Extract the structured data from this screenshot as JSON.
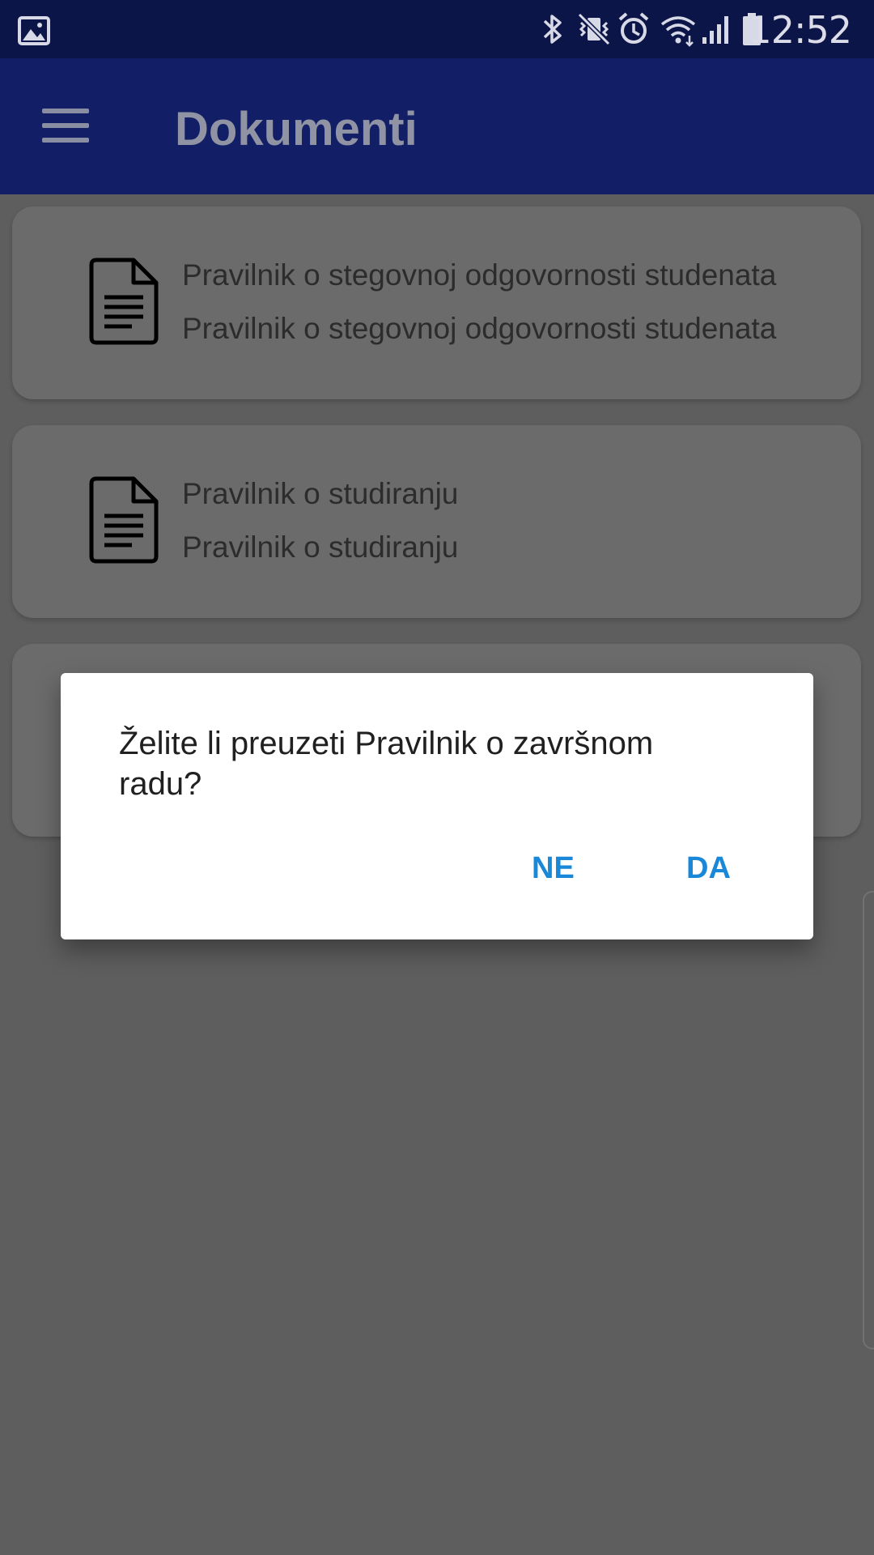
{
  "status_bar": {
    "time": "12:52",
    "left_icons": [
      "gallery-icon"
    ],
    "right_icons": [
      "bluetooth-icon",
      "vibrate-mute-icon",
      "alarm-icon",
      "wifi-icon",
      "signal-icon",
      "battery-icon"
    ]
  },
  "app_bar": {
    "title": "Dokumenti",
    "menu_icon": "hamburger-menu-icon"
  },
  "documents": [
    {
      "icon": "document-icon",
      "title": "Pravilnik o stegovnoj odgovornosti studenata",
      "subtitle": "Pravilnik o stegovnoj odgovornosti studenata"
    },
    {
      "icon": "document-icon",
      "title": "Pravilnik o studiranju",
      "subtitle": "Pravilnik o studiranju"
    },
    {
      "icon": "document-icon",
      "title": "",
      "subtitle": ""
    }
  ],
  "dialog": {
    "message": "Želite li preuzeti Pravilnik o završnom radu?",
    "negative_label": "NE",
    "positive_label": "DA"
  },
  "colors": {
    "status_bar": "#0c1547",
    "app_bar": "#121f66",
    "scrim_background": "#5e5e5e",
    "card": "#6b6b6b",
    "dialog_button": "#1a88d8"
  }
}
